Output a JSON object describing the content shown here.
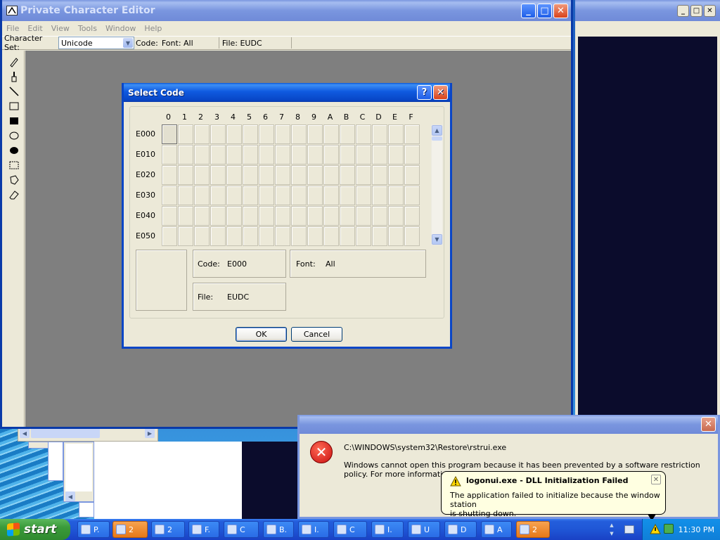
{
  "pce": {
    "title": "Private Character Editor",
    "menu": [
      "File",
      "Edit",
      "View",
      "Tools",
      "Window",
      "Help"
    ],
    "charset_label": "Character Set:",
    "charset_value": "Unicode",
    "code_label": "Code:",
    "font_label": "Font: All",
    "file_label": "File: EUDC"
  },
  "dialog": {
    "title": "Select Code",
    "help_glyph": "?",
    "close_glyph": "✕",
    "columns": [
      "0",
      "1",
      "2",
      "3",
      "4",
      "5",
      "6",
      "7",
      "8",
      "9",
      "A",
      "B",
      "C",
      "D",
      "E",
      "F"
    ],
    "rows": [
      "E000",
      "E010",
      "E020",
      "E030",
      "E040",
      "E050"
    ],
    "code_label": "Code:",
    "code_value": "E000",
    "font_label": "Font:",
    "font_value": "All",
    "file_label": "File:",
    "file_value": "EUDC",
    "ok": "OK",
    "cancel": "Cancel"
  },
  "error": {
    "path": "C:\\WINDOWS\\system32\\Restore\\rstrui.exe",
    "message": "Windows cannot open this program because it has been prevented by a software restriction policy. For more information, open Event View"
  },
  "balloon": {
    "title": "logonui.exe - DLL Initialization Failed",
    "message_line1": "The application failed to initialize because the window station",
    "message_line2": "is shutting down."
  },
  "taskbar": {
    "start": "start",
    "buttons": [
      {
        "label": "P."
      },
      {
        "label": "2"
      },
      {
        "label": "2"
      },
      {
        "label": "F."
      },
      {
        "label": "C"
      },
      {
        "label": "B."
      },
      {
        "label": "I."
      },
      {
        "label": "C"
      },
      {
        "label": "I."
      },
      {
        "label": "U"
      },
      {
        "label": "D"
      },
      {
        "label": "A"
      },
      {
        "label": "2"
      }
    ],
    "clock": "11:30 PM"
  }
}
